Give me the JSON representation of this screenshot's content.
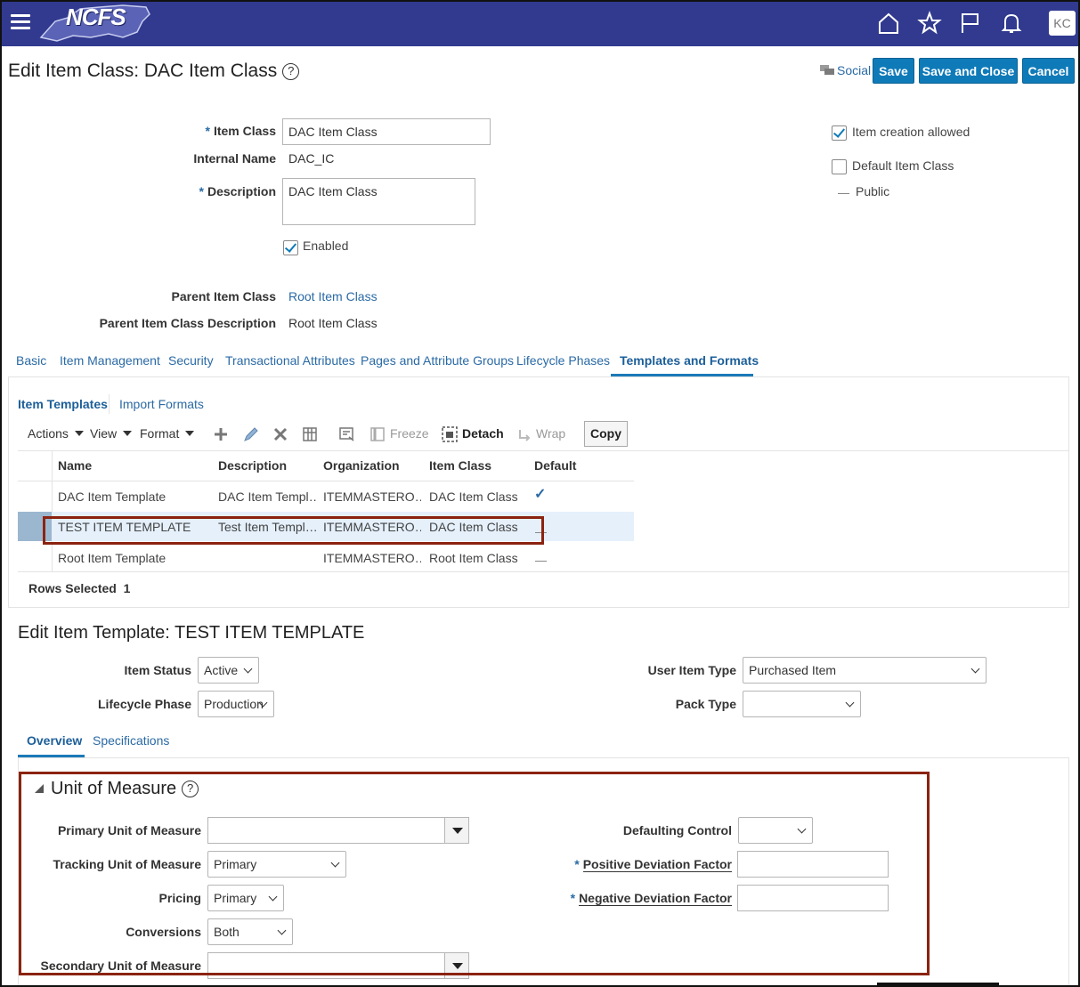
{
  "header": {
    "logo_text": "NCFS",
    "icons": [
      "home-icon",
      "star-icon",
      "flag-icon",
      "bell-icon"
    ],
    "avatar_initials": "KC"
  },
  "page": {
    "title": "Edit Item Class: DAC Item Class",
    "help": "?",
    "social_label": "Social",
    "save_label": "Save",
    "save_close_label": "Save and Close",
    "cancel_label": "Cancel"
  },
  "form": {
    "item_class_label": "Item Class",
    "item_class_value": "DAC Item Class",
    "internal_name_label": "Internal Name",
    "internal_name_value": "DAC_IC",
    "description_label": "Description",
    "description_value": "DAC Item Class",
    "enabled_label": "Enabled",
    "enabled": true,
    "parent_label": "Parent Item Class",
    "parent_value": "Root Item Class",
    "parent_desc_label": "Parent Item Class Description",
    "parent_desc_value": "Root Item Class",
    "item_creation_label": "Item creation allowed",
    "item_creation": true,
    "default_class_label": "Default Item Class",
    "default_class": false,
    "public_label": "Public"
  },
  "tabs": [
    "Basic",
    "Item Management",
    "Security",
    "Transactional Attributes",
    "Pages and Attribute Groups",
    "Lifecycle Phases",
    "Templates and Formats"
  ],
  "subtabs": [
    "Item Templates",
    "Import Formats"
  ],
  "toolbar": {
    "actions": "Actions",
    "view": "View",
    "format": "Format",
    "freeze": "Freeze",
    "detach": "Detach",
    "wrap": "Wrap",
    "copy": "Copy"
  },
  "table": {
    "columns": [
      "Name",
      "Description",
      "Organization",
      "Item Class",
      "Default"
    ],
    "rows": [
      {
        "name": "DAC Item Template",
        "description": "DAC Item Templ…",
        "organization": "ITEMMASTERO…",
        "item_class": "DAC Item Class",
        "default": "✓"
      },
      {
        "name": "TEST ITEM TEMPLATE",
        "description": "Test Item Templ…",
        "organization": "ITEMMASTERO…",
        "item_class": "DAC Item Class",
        "default": ""
      },
      {
        "name": "Root Item Template",
        "description": "",
        "organization": "ITEMMASTERO…",
        "item_class": "Root Item Class",
        "default": ""
      }
    ],
    "rows_selected_label": "Rows Selected",
    "rows_selected_value": "1"
  },
  "template_edit": {
    "title": "Edit Item Template: TEST ITEM TEMPLATE",
    "item_status_label": "Item Status",
    "item_status_value": "Active",
    "lifecycle_label": "Lifecycle Phase",
    "lifecycle_value": "Production",
    "user_item_type_label": "User Item Type",
    "user_item_type_value": "Purchased Item",
    "pack_type_label": "Pack Type",
    "pack_type_value": "",
    "subtabs": [
      "Overview",
      "Specifications"
    ]
  },
  "uom": {
    "title": "Unit of Measure",
    "primary_label": "Primary Unit of Measure",
    "primary_value": "",
    "tracking_label": "Tracking Unit of Measure",
    "tracking_value": "Primary",
    "pricing_label": "Pricing",
    "pricing_value": "Primary",
    "conversions_label": "Conversions",
    "conversions_value": "Both",
    "secondary_label": "Secondary Unit of Measure",
    "secondary_value": "",
    "defaulting_label": "Defaulting Control",
    "defaulting_value": "",
    "positive_label": "Positive Deviation Factor",
    "positive_value": "",
    "negative_label": "Negative Deviation Factor",
    "negative_value": ""
  },
  "colors": {
    "header_bg": "#313a8f",
    "button_blue": "#0f7ab8",
    "link_blue": "#2a6aa5",
    "highlight_red": "#8b2310"
  }
}
